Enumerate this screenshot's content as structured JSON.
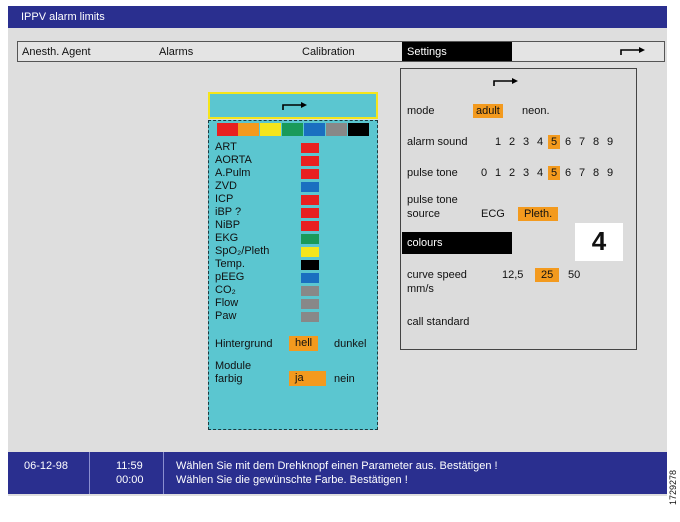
{
  "window": {
    "title": "IPPV alarm limits"
  },
  "menu": {
    "items": [
      {
        "label": "Anesth. Agent"
      },
      {
        "label": "Alarms"
      },
      {
        "label": "Calibration"
      }
    ],
    "selected_label": "Settings",
    "arrow_icon": "enter-arrow-icon"
  },
  "settings": {
    "arrow_icon": "enter-arrow-icon",
    "mode_label": "mode",
    "mode_options": [
      "adult",
      "neon."
    ],
    "mode_selected": "adult",
    "alarm_sound_label": "alarm sound",
    "alarm_sound_options": [
      "1",
      "2",
      "3",
      "4",
      "5",
      "6",
      "7",
      "8",
      "9"
    ],
    "alarm_sound_selected": "5",
    "pulse_tone_label": "pulse tone",
    "pulse_tone_options": [
      "0",
      "1",
      "2",
      "3",
      "4",
      "5",
      "6",
      "7",
      "8",
      "9"
    ],
    "pulse_tone_selected": "5",
    "pulse_source_label_1": "pulse tone",
    "pulse_source_label_2": "source",
    "pulse_source_options": [
      "ECG",
      "Pleth."
    ],
    "pulse_source_selected": "Pleth.",
    "colours_label": "colours",
    "step_number": "4",
    "curve_speed_label_1": "curve speed",
    "curve_speed_label_2": "mm/s",
    "curve_speed_options": [
      "12,5",
      "25",
      "50"
    ],
    "curve_speed_selected": "25",
    "call_standard_label": "call standard"
  },
  "colours": {
    "header_arrow_icon": "enter-arrow-icon",
    "palette": [
      "#e82020",
      "#f39a1e",
      "#f5e51b",
      "#1a9a5a",
      "#1a6fc0",
      "#888888",
      "#000000"
    ],
    "parameters": [
      {
        "label": "ART",
        "color": "#e82020"
      },
      {
        "label": "AORTA",
        "color": "#e82020"
      },
      {
        "label": "A.Pulm",
        "color": "#e82020"
      },
      {
        "label": "ZVD",
        "color": "#1a6fc0"
      },
      {
        "label": "ICP",
        "color": "#e82020"
      },
      {
        "label": "iBP ?",
        "color": "#e82020"
      },
      {
        "label": "NiBP",
        "color": "#e82020"
      },
      {
        "label": "EKG",
        "color": "#1a9a5a"
      },
      {
        "label": "SpO₂/Pleth",
        "color": "#f5e51b"
      },
      {
        "label": "Temp.",
        "color": "#000000"
      },
      {
        "label": "pEEG",
        "color": "#1a6fc0"
      },
      {
        "label": "CO₂",
        "color": "#888888"
      },
      {
        "label": "Flow",
        "color": "#888888"
      },
      {
        "label": "Paw",
        "color": "#888888"
      }
    ],
    "background_label": "Hintergrund",
    "background_options": [
      "hell",
      "dunkel"
    ],
    "background_selected": "hell",
    "module_label_1": "Module",
    "module_label_2": "farbig",
    "module_options": [
      "ja",
      "nein"
    ],
    "module_selected": "ja"
  },
  "status": {
    "date": "06-12-98",
    "time_1": "11:59",
    "time_2": "00:00",
    "message_1": "Wählen Sie mit dem Drehknopf einen Parameter aus. Bestätigen !",
    "message_2": "Wählen Sie die gewünschte Farbe. Bestätigen !"
  },
  "figure_code": "1729278",
  "theme": {
    "title_bar": "#2a2f8f",
    "highlight": "#f39a1e",
    "colour_panel": "#5bc6d0",
    "colour_panel_header_border": "#f5e51b"
  }
}
